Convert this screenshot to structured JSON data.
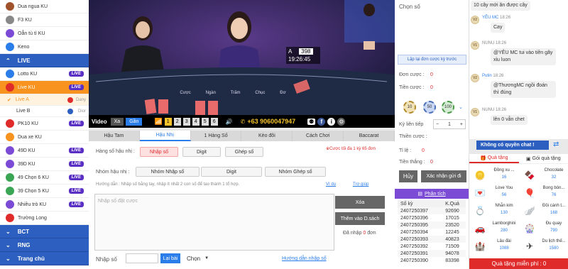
{
  "sidebar": {
    "items_top": [
      {
        "label": "Dua ngua KU",
        "icon": "horse-icon",
        "color": "#a0522d"
      },
      {
        "label": "F3 KU",
        "icon": "f3-icon",
        "color": "#888"
      },
      {
        "label": "Oẳn tù tì KU",
        "icon": "rps-icon",
        "color": "#7b4bd6"
      },
      {
        "label": "Keno",
        "icon": "keno-icon",
        "color": "#2b7de9"
      }
    ],
    "live_header": "LIVE",
    "live_items": [
      {
        "label": "Lotto KU",
        "badge": "LIVE",
        "icon": "lotto-icon",
        "color": "#2b7de9"
      },
      {
        "label": "Live KU",
        "badge": "LIVE",
        "icon": "live-ku-icon",
        "color": "#e02b2b"
      }
    ],
    "sub_items": [
      {
        "label": "Live A",
        "dealer": "Dany",
        "flag": "#e02b2b"
      },
      {
        "label": "Live B",
        "dealer": "Dior",
        "flag": "#2b5fc0"
      }
    ],
    "items_bottom": [
      {
        "label": "PK10 KU",
        "badge": "LIVE",
        "icon": "pk10-icon",
        "color": "#e02b2b"
      },
      {
        "label": "Dua xe KU",
        "badge": "",
        "icon": "car-icon",
        "color": "#f7931e"
      },
      {
        "label": "49D KU",
        "badge": "LIVE",
        "icon": "49d-icon",
        "color": "#7b4bd6"
      },
      {
        "label": "39D KU",
        "badge": "LIVE",
        "icon": "39d-icon",
        "color": "#7b4bd6"
      },
      {
        "label": "49 Chọn 6 KU",
        "badge": "LIVE",
        "icon": "49c6-icon",
        "color": "#3aa655"
      },
      {
        "label": "39 Chọn 5 KU",
        "badge": "LIVE",
        "icon": "39c5-icon",
        "color": "#3aa655"
      },
      {
        "label": "Nhiều trò KU",
        "badge": "LIVE",
        "icon": "multi-icon",
        "color": "#7b4bd6"
      },
      {
        "label": "Trường Long",
        "badge": "",
        "icon": "dragon-icon",
        "color": "#e02b2b"
      }
    ],
    "sections": [
      "BCT",
      "RNG",
      "Trang chủ"
    ]
  },
  "video": {
    "round_label": "A",
    "round_value": "398",
    "time": "19:26:45",
    "bar_label": "Video",
    "btn_far": "Xa",
    "btn_near": "Gần",
    "numbers": [
      "1",
      "2",
      "3",
      "4",
      "5",
      "6"
    ],
    "hotline": "+63 9060047947",
    "sign_labels": [
      "Cược",
      "Ngàn",
      "Trăm",
      "Chục",
      "Đơ"
    ]
  },
  "bet": {
    "tabs": [
      "Hậu Tam",
      "Hậu Nhị",
      "1 Hàng Số",
      "Kèo đôi",
      "Cách Chơi",
      "Baccarat"
    ],
    "row1_label": "Hàng số hậu nhị :",
    "row1_btns": [
      "Nhập số",
      "Digit",
      "Ghép số"
    ],
    "limit_note": "※Cược tối đa 1 kỳ 65 đơn",
    "row2_label": "Nhóm hậu nhị :",
    "row2_btns": [
      "Nhóm Nhập số",
      "Digit",
      "Nhóm Ghép số"
    ],
    "guide": "Hướng dẫn : Nhập số bằng tay, nhập ít nhất 2 con số để tạo thành 1 tổ hợp.",
    "example": "Ví dụ",
    "help": "Trợ giúp",
    "textarea_placeholder": "Nhập số đặt cược",
    "delete": "Xóa",
    "add_list": "Thêm vào D.sách",
    "entered_prefix": "Đã nhập ",
    "entered_count": "0",
    "entered_suffix": " đơn",
    "number_label": "Nhập số",
    "reset": "Lại bài",
    "choose": "Chọn",
    "guide_link": "Hướng dẫn nhập số"
  },
  "mid": {
    "choose_label": "Chọn số",
    "repeat_btn": "Lặp lại đơn cược kỳ trước",
    "order_label": "Đơn cược :",
    "order_val": "0",
    "amount_label": "Tiền cược :",
    "amount_val": "0",
    "chips": [
      "10",
      "50",
      "100"
    ],
    "next_label": "Kỳ liên tiếp",
    "next_val": "1",
    "win_label": "Thiền cược :",
    "ratio_label": "Tỉ lệ :",
    "ratio_val": "0",
    "won_label": "Tiền thắng :",
    "won_val": "0",
    "cancel_btn": "Hủy",
    "confirm_btn": "Xác nhận gửi đi",
    "analysis": "Phân tích",
    "th_period": "Số kỳ",
    "th_result": "K.Quả",
    "rows": [
      [
        "2407250397",
        "92690"
      ],
      [
        "2407250396",
        "17015"
      ],
      [
        "2407250395",
        "23520"
      ],
      [
        "2407250394",
        "12245"
      ],
      [
        "2407250393",
        "40823"
      ],
      [
        "2407250392",
        "71509"
      ],
      [
        "2407250391",
        "94078"
      ],
      [
        "2407250390",
        "83398"
      ]
    ]
  },
  "chat": {
    "msgs": [
      {
        "level": "",
        "name": "",
        "time": "",
        "text": "10 cây mới ăn được cây"
      },
      {
        "level": "V2",
        "name": "YÊU MC",
        "time": "18:26",
        "text": "Cay"
      },
      {
        "level": "V1",
        "name": "NUNU",
        "time": "18:26",
        "text": "@YÊU MC tui vào tiền gãy xỉu luon"
      },
      {
        "level": "V2",
        "name": "Putin",
        "time": "18:26",
        "text": "@ThươngMC ngồi đoán thì đúng"
      },
      {
        "level": "V1",
        "name": "NUNU",
        "time": "18:26",
        "text": "lên 0 vẫn chet"
      }
    ],
    "no_permission": "Không có quyền chat !",
    "tab_gift": "Quà tặng",
    "tab_bag": "Gói quà tặng",
    "gifts": [
      {
        "name": "Đồng xu ...",
        "val": "16"
      },
      {
        "name": "Chocolate",
        "val": "32"
      },
      {
        "name": "Love You",
        "val": "56"
      },
      {
        "name": "Bong bón...",
        "val": "76"
      },
      {
        "name": "Nhẫn kim",
        "val": "130"
      },
      {
        "name": "Đồi cánh t...",
        "val": "168"
      },
      {
        "name": "Lamborghini",
        "val": "280"
      },
      {
        "name": "Đu quay",
        "val": "790"
      },
      {
        "name": "Lâu đài",
        "val": "1088"
      },
      {
        "name": "Du lịch thế...",
        "val": "1580"
      }
    ],
    "free_gift": "Quà tặng miễn phí : ",
    "free_val": "0"
  }
}
